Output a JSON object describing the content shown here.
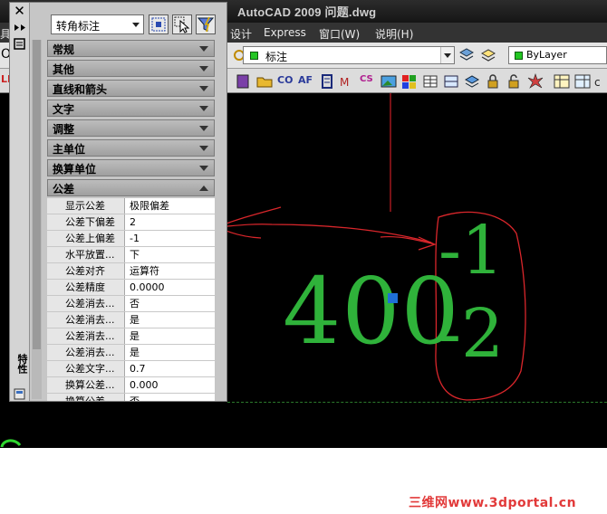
{
  "window": {
    "title": "AutoCAD 2009 问题.dwg"
  },
  "menu": {
    "items": [
      "具",
      "设计",
      "Express",
      "窗口(W)",
      "说明(H)"
    ]
  },
  "toolbar": {
    "layer_combo": "标注",
    "color_combo": "ByLayer",
    "left_fragment": "O",
    "row3_fragments": [
      "LB",
      "CO",
      "AF",
      "CS"
    ]
  },
  "properties": {
    "object_type": "转角标注",
    "panel_title": "特性",
    "sections": [
      {
        "label": "常规",
        "expanded": false
      },
      {
        "label": "其他",
        "expanded": false
      },
      {
        "label": "直线和箭头",
        "expanded": false
      },
      {
        "label": "文字",
        "expanded": false
      },
      {
        "label": "调整",
        "expanded": false
      },
      {
        "label": "主单位",
        "expanded": false
      },
      {
        "label": "换算单位",
        "expanded": false
      },
      {
        "label": "公差",
        "expanded": true
      }
    ],
    "tolerance_rows": [
      {
        "key": "显示公差",
        "value": "极限偏差"
      },
      {
        "key": "公差下偏差",
        "value": "2"
      },
      {
        "key": "公差上偏差",
        "value": "-1"
      },
      {
        "key": "水平放置...",
        "value": "下"
      },
      {
        "key": "公差对齐",
        "value": "运算符"
      },
      {
        "key": "公差精度",
        "value": "0.0000"
      },
      {
        "key": "公差消去...",
        "value": "否"
      },
      {
        "key": "公差消去...",
        "value": "是"
      },
      {
        "key": "公差消去...",
        "value": "是"
      },
      {
        "key": "公差消去...",
        "value": "是"
      },
      {
        "key": "公差文字...",
        "value": "0.7"
      },
      {
        "key": "换算公差...",
        "value": "0.000"
      },
      {
        "key": "换算公差...",
        "value": "否"
      }
    ]
  },
  "drawing": {
    "dimension_value": "400",
    "upper_tolerance": "-1",
    "lower_tolerance": "-2",
    "text_color": "#2fb23a",
    "annotation_color": "#e0262a"
  },
  "watermark": "三维网www.3dportal.cn"
}
